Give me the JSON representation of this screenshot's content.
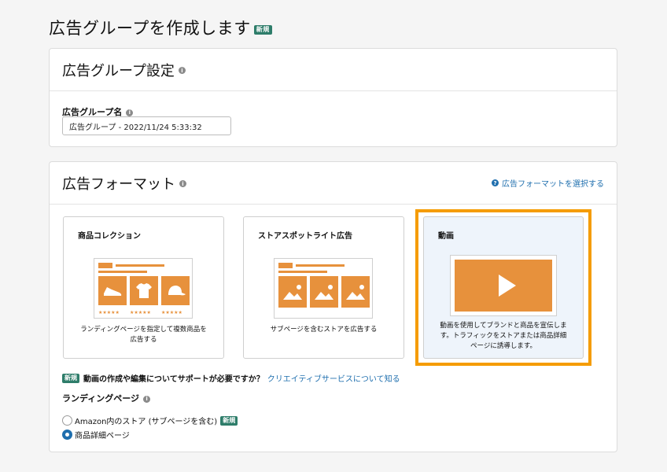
{
  "header": {
    "title": "広告グループを作成します",
    "new_badge": "新規"
  },
  "settings": {
    "title": "広告グループ設定",
    "name_label": "広告グループ名",
    "name_value": "広告グループ - 2022/11/24 5:33:32"
  },
  "format": {
    "title": "広告フォーマット",
    "help_link": "広告フォーマットを選択する",
    "cards": [
      {
        "title": "商品コレクション",
        "desc_line1": "ランディングページを指定して複数商品を",
        "desc_line2": "広告する",
        "selected": false
      },
      {
        "title": "ストアスポットライト広告",
        "desc_line1": "サブページを含むストアを広告する",
        "desc_line2": "",
        "selected": false
      },
      {
        "title": "動画",
        "desc_line1": "動画を使用してブランドと商品を宣伝しま",
        "desc_line2": "す。トラフィックをストアまたは商品詳細",
        "desc_line3": "ページに誘導します。",
        "selected": true
      }
    ],
    "note": {
      "badge": "新規",
      "question": "動画の作成や編集についてサポートが必要ですか？",
      "link": "クリエイティブサービスについて知る"
    },
    "landing": {
      "label": "ランディングページ",
      "options": [
        {
          "label": "Amazon内のストア (サブページを含む)",
          "badge": "新規",
          "checked": false
        },
        {
          "label": "商品詳細ページ",
          "checked": true
        }
      ]
    }
  },
  "colors": {
    "accent_orange": "#f59c00",
    "illustration": "#e7913c",
    "link_blue": "#1f6fae",
    "badge_green": "#2e7d6a"
  },
  "icons": {
    "info": "info-icon",
    "help": "question-circle-icon",
    "play": "play-icon"
  }
}
